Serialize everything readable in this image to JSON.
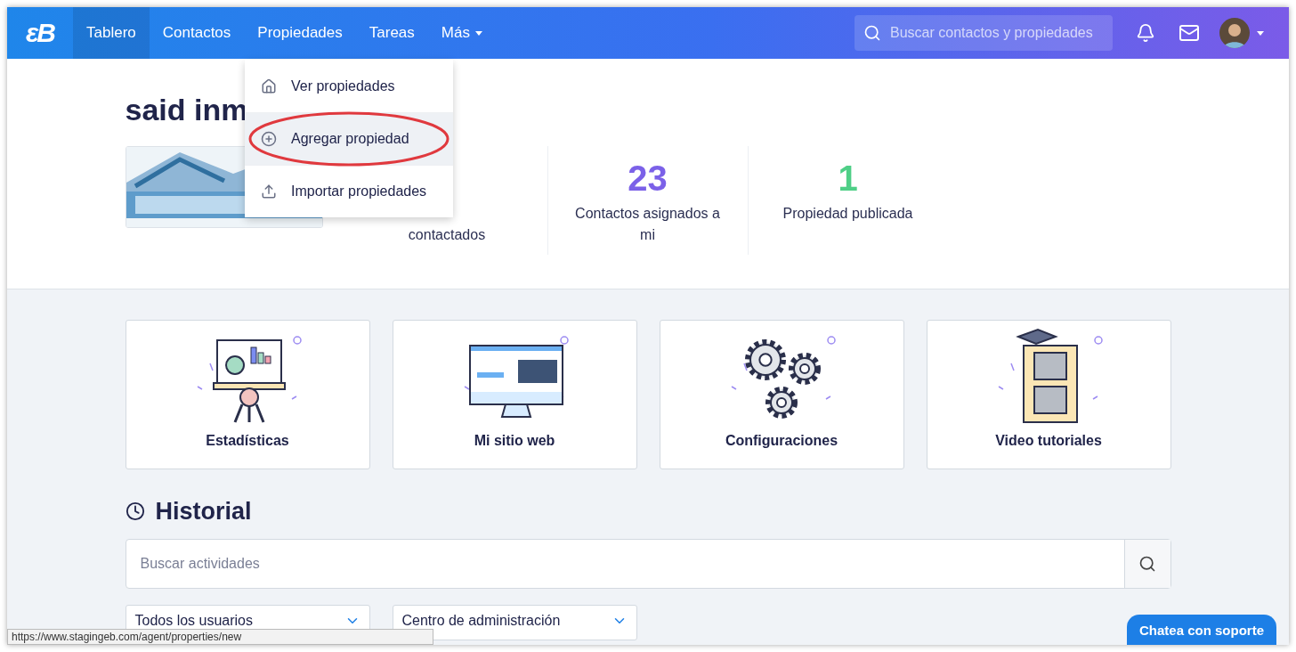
{
  "navbar": {
    "logo": "εB",
    "items": [
      {
        "label": "Tablero",
        "selected": true
      },
      {
        "label": "Contactos",
        "selected": false
      },
      {
        "label": "Propiedades",
        "selected": false
      },
      {
        "label": "Tareas",
        "selected": false
      },
      {
        "label": "Más",
        "selected": false,
        "caret": true
      }
    ],
    "search": {
      "placeholder": "Buscar contactos y propiedades"
    }
  },
  "dropdown": {
    "items": [
      {
        "label": "Ver propiedades",
        "kind": "home",
        "selected": false,
        "circled": false
      },
      {
        "label": "Agregar propiedad",
        "kind": "add",
        "selected": true,
        "circled": true
      },
      {
        "label": "Importar propiedades",
        "kind": "import",
        "selected": false,
        "circled": false
      }
    ]
  },
  "account": {
    "title": "said inm",
    "stats": [
      {
        "label": "contactados"
      },
      {
        "value": "23",
        "label": "Contactos asignados a mi",
        "color": "#7b61e8"
      },
      {
        "value": "1",
        "label": "Propiedad publicada",
        "color": "#4fcf87"
      }
    ]
  },
  "shortcuts": [
    {
      "label": "Estadísticas",
      "kind": "stats"
    },
    {
      "label": "Mi sitio web",
      "kind": "web"
    },
    {
      "label": "Configuraciones",
      "kind": "gears"
    },
    {
      "label": "Video tutoriales",
      "kind": "video"
    }
  ],
  "history": {
    "title": "Historial",
    "search": {
      "placeholder": "Buscar actividades"
    },
    "filters": [
      "Todos los usuarios",
      "Centro de administración"
    ]
  },
  "status_url": "https://www.stagingeb.com/agent/properties/new",
  "chat_button": "Chatea con soporte"
}
